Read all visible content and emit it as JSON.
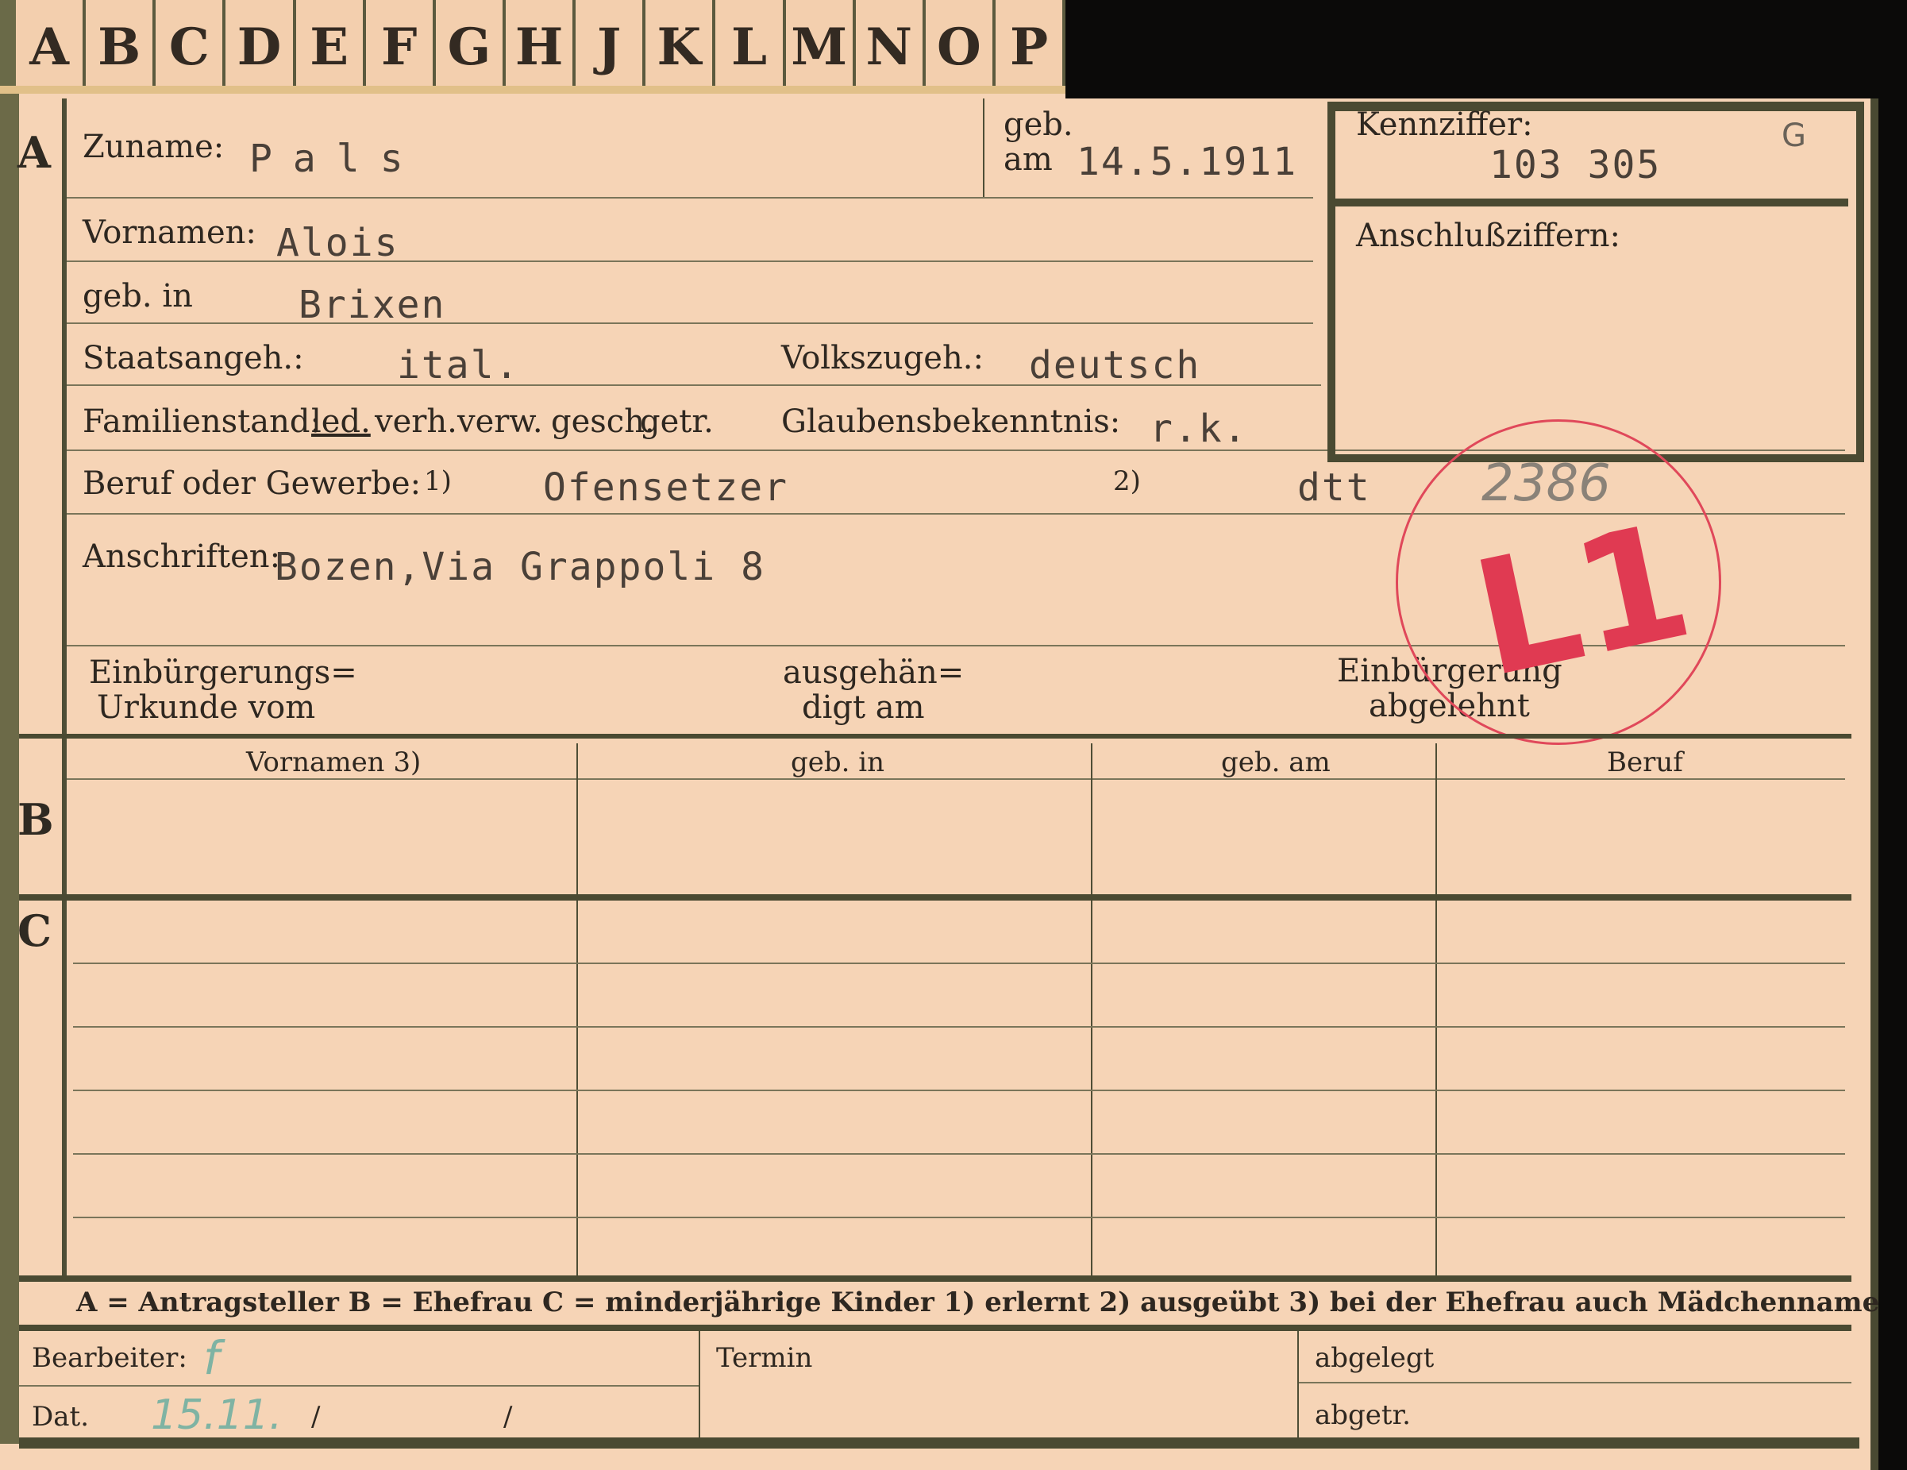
{
  "tabs": [
    "A",
    "B",
    "C",
    "D",
    "E",
    "F",
    "G",
    "H",
    "J",
    "K",
    "L",
    "M",
    "N",
    "O",
    "P"
  ],
  "sections": {
    "a": "A",
    "b": "B",
    "c": "C"
  },
  "header": {
    "zuname_label": "Zuname:",
    "zuname_value": "Pals",
    "geb_label": "geb.",
    "am_label": "am",
    "geb_value": "14.5.1911",
    "kennziffer_label": "Kennziffer:",
    "kennziffer_value": "103 305",
    "kennziffer_suffix": "G",
    "anschluss_label": "Anschlußziffern:"
  },
  "fields": {
    "vornamen_label": "Vornamen:",
    "vornamen_value": "Alois",
    "gebin_label": "geb. in",
    "gebin_value": "Brixen",
    "staat_label": "Staatsangeh.:",
    "staat_value": "ital.",
    "volk_label": "Volkszugeh.:",
    "volk_value": "deutsch",
    "familien_label": "Familienstand:",
    "familien_options": [
      "led.",
      "verh.",
      "verw.",
      "gesch.",
      "getr."
    ],
    "glauben_label": "Glaubensbekenntnis:",
    "glauben_value": "r.k.",
    "beruf_label": "Beruf oder Gewerbe:",
    "beruf_marker1": "1)",
    "beruf_value1": "Ofensetzer",
    "beruf_marker2": "2)",
    "beruf_value2": "dtt",
    "anschrift_label": "Anschriften:",
    "anschrift_value": "Bozen,Via Grappoli 8",
    "einb_urkunde_label1": "Einbürgerungs=",
    "einb_urkunde_label2": "Urkunde vom",
    "ausgeh_label1": "ausgehän=",
    "ausgeh_label2": "digt am",
    "einb_abgelehnt_label1": "Einbürgerung",
    "einb_abgelehnt_label2": "abgelehnt"
  },
  "stamp": {
    "text": "L1",
    "pencil_number": "2386",
    "color": "#e03a52"
  },
  "table": {
    "headers": [
      "Vornamen 3)",
      "geb. in",
      "geb. am",
      "Beruf"
    ]
  },
  "legend": "A = Antragsteller   B = Ehefrau   C = minderjährige Kinder   1) erlernt   2) ausgeübt   3) bei der Ehefrau auch Mädchenname",
  "footer": {
    "bearbeiter_label": "Bearbeiter:",
    "bearbeiter_value": "f",
    "dat_label": "Dat.",
    "dat_value": "15.11.",
    "dat_sep1": "/",
    "dat_sep2": "/",
    "termin_label": "Termin",
    "abgelegt_label": "abgelegt",
    "abgetr_label": "abgetr."
  }
}
